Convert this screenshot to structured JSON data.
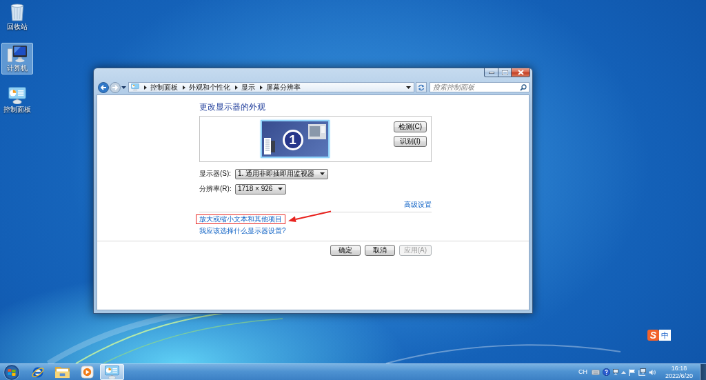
{
  "desktop": {
    "icons": [
      {
        "kind": "recycle-bin",
        "label": "回收站",
        "selected": false
      },
      {
        "kind": "computer",
        "label": "计算机",
        "selected": true
      },
      {
        "kind": "control-panel",
        "label": "控制面板",
        "selected": false
      }
    ]
  },
  "window": {
    "navigation": {
      "back_enabled": true,
      "forward_enabled": false
    },
    "address_bar": {
      "breadcrumb": [
        "控制面板",
        "外观和个性化",
        "显示",
        "屏幕分辨率"
      ]
    },
    "search": {
      "placeholder": "搜索控制面板"
    },
    "heading": "更改显示器的外观",
    "preview": {
      "monitors": [
        {
          "number": "1",
          "selected": true
        }
      ],
      "buttons": [
        {
          "label": "检测(C)"
        },
        {
          "label": "识别(I)"
        }
      ]
    },
    "fields": [
      {
        "label": "显示器(S):",
        "value": "1. 通用非即插即用监视器"
      },
      {
        "label": "分辨率(R):",
        "value": "1718 × 926"
      }
    ],
    "advanced_link": "高级设置",
    "links": [
      {
        "text": "放大或缩小文本和其他项目",
        "highlighted": true
      },
      {
        "text": "我应该选择什么显示器设置?",
        "highlighted": false
      }
    ],
    "buttons": [
      {
        "label": "确定",
        "disabled": false
      },
      {
        "label": "取消",
        "disabled": false
      },
      {
        "label": "应用(A)",
        "disabled": true
      }
    ]
  },
  "ime": {
    "logo": "S",
    "mode": "中"
  },
  "taskbar": {
    "apps": [
      {
        "kind": "browser",
        "selected": false
      },
      {
        "kind": "folder",
        "selected": false
      },
      {
        "kind": "media-player",
        "selected": false
      },
      {
        "kind": "control-panel",
        "selected": true
      }
    ],
    "language": "CH",
    "time": "16:18",
    "date": "2022/6/20"
  }
}
